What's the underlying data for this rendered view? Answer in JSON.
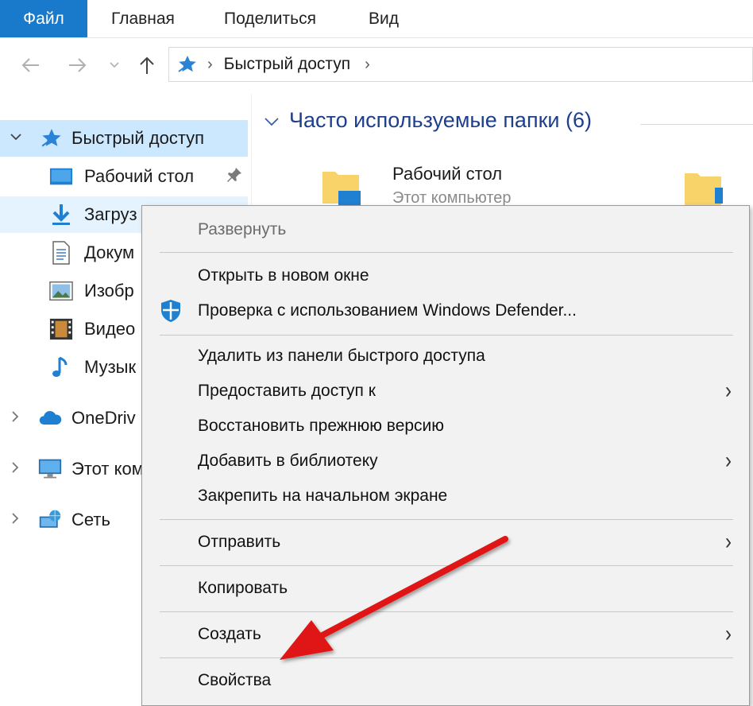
{
  "ribbon": {
    "tabs": [
      "Файл",
      "Главная",
      "Поделиться",
      "Вид"
    ],
    "accent_color": "#1979ca"
  },
  "nav": {
    "back_icon": "arrow-left-icon",
    "forward_icon": "arrow-right-icon",
    "recent_icon": "chevron-down-icon",
    "up_icon": "arrow-up-icon"
  },
  "address": {
    "location": "Быстрый доступ",
    "icon": "star-icon"
  },
  "sidebar": {
    "items": [
      {
        "label": "Быстрый доступ",
        "icon": "star-icon",
        "state": "selected"
      },
      {
        "label": "Рабочий стол",
        "icon": "desktop-icon",
        "pinned": true
      },
      {
        "label": "Загруз",
        "icon": "download-icon",
        "state": "hover"
      },
      {
        "label": "Докум",
        "icon": "document-icon"
      },
      {
        "label": "Изобр",
        "icon": "image-icon"
      },
      {
        "label": "Видео",
        "icon": "video-icon"
      },
      {
        "label": "Музык",
        "icon": "music-icon"
      },
      {
        "label": "OneDriv",
        "icon": "cloud-icon"
      },
      {
        "label": "Этот ком",
        "icon": "computer-icon"
      },
      {
        "label": "Сеть",
        "icon": "network-icon"
      }
    ]
  },
  "main": {
    "group_title": "Часто используемые папки (6)",
    "tile": {
      "title": "Рабочий стол",
      "subtitle": "Этот компьютер"
    }
  },
  "context_menu": {
    "items": [
      {
        "label": "Развернуть",
        "disabled": true
      },
      {
        "label": "Открыть в новом окне"
      },
      {
        "label": "Проверка с использованием Windows Defender...",
        "icon": "shield-icon"
      },
      {
        "label": "Удалить из панели быстрого доступа"
      },
      {
        "label": "Предоставить доступ к",
        "submenu": true
      },
      {
        "label": "Восстановить прежнюю версию"
      },
      {
        "label": "Добавить в библиотеку",
        "submenu": true
      },
      {
        "label": "Закрепить на начальном экране"
      },
      {
        "label": "Отправить",
        "submenu": true
      },
      {
        "label": "Копировать"
      },
      {
        "label": "Создать",
        "submenu": true
      },
      {
        "label": "Свойства"
      }
    ],
    "annotation_arrow_color": "#e01818"
  }
}
